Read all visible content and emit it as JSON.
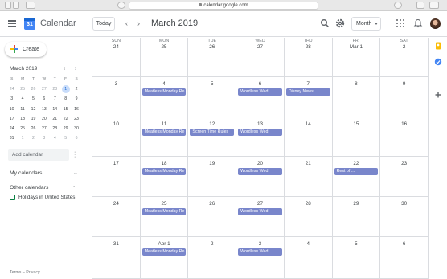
{
  "browser": {
    "url": "calendar.google.com"
  },
  "app": {
    "title": "Calendar",
    "logo_text": "31"
  },
  "header": {
    "today_label": "Today",
    "prev_icon": "chevron-left-icon",
    "next_icon": "chevron-right-icon",
    "month_title": "March 2019",
    "view_label": "Month"
  },
  "sidebar": {
    "create_label": "Create",
    "mini_calendar": {
      "title": "March 2019",
      "days_of_week": [
        "S",
        "M",
        "T",
        "W",
        "T",
        "F",
        "S"
      ],
      "weeks": [
        [
          "24",
          "25",
          "26",
          "27",
          "28",
          "1",
          "2"
        ],
        [
          "3",
          "4",
          "5",
          "6",
          "7",
          "8",
          "9"
        ],
        [
          "10",
          "11",
          "12",
          "13",
          "14",
          "15",
          "16"
        ],
        [
          "17",
          "18",
          "19",
          "20",
          "21",
          "22",
          "23"
        ],
        [
          "24",
          "25",
          "26",
          "27",
          "28",
          "29",
          "30"
        ],
        [
          "31",
          "1",
          "2",
          "3",
          "4",
          "5",
          "6"
        ]
      ],
      "today": "1"
    },
    "add_calendar_placeholder": "Add calendar",
    "my_calendars_label": "My calendars",
    "other_calendars_label": "Other calendars",
    "other_calendars": [
      {
        "label": "Holidays in United States",
        "color": "#0b8043"
      }
    ],
    "footer": "Terms – Privacy"
  },
  "calendar": {
    "days_of_week": [
      "SUN",
      "MON",
      "TUE",
      "WED",
      "THU",
      "FRI",
      "SAT"
    ],
    "event_color": "#7986cb",
    "weeks": [
      [
        {
          "date": "24",
          "events": []
        },
        {
          "date": "25",
          "events": []
        },
        {
          "date": "26",
          "events": []
        },
        {
          "date": "27",
          "events": []
        },
        {
          "date": "28",
          "events": []
        },
        {
          "date": "Mar 1",
          "events": []
        },
        {
          "date": "2",
          "events": []
        }
      ],
      [
        {
          "date": "3",
          "events": []
        },
        {
          "date": "4",
          "events": [
            "Meatless Monday Re"
          ]
        },
        {
          "date": "5",
          "events": []
        },
        {
          "date": "6",
          "events": [
            "Wordless Wed"
          ]
        },
        {
          "date": "7",
          "events": [
            "Disney News"
          ]
        },
        {
          "date": "8",
          "events": []
        },
        {
          "date": "9",
          "events": []
        }
      ],
      [
        {
          "date": "10",
          "events": []
        },
        {
          "date": "11",
          "events": [
            "Meatless Monday Re"
          ]
        },
        {
          "date": "12",
          "events": [
            "Screen Time Rules"
          ]
        },
        {
          "date": "13",
          "events": [
            "Wordless Wed"
          ]
        },
        {
          "date": "14",
          "events": []
        },
        {
          "date": "15",
          "events": []
        },
        {
          "date": "16",
          "events": []
        }
      ],
      [
        {
          "date": "17",
          "events": []
        },
        {
          "date": "18",
          "events": [
            "Meatless Monday Re"
          ]
        },
        {
          "date": "19",
          "events": []
        },
        {
          "date": "20",
          "events": [
            "Wordless Wed"
          ]
        },
        {
          "date": "21",
          "events": []
        },
        {
          "date": "22",
          "events": [
            "Rest of ..."
          ]
        },
        {
          "date": "23",
          "events": []
        }
      ],
      [
        {
          "date": "24",
          "events": []
        },
        {
          "date": "25",
          "events": [
            "Meatless Monday Re"
          ]
        },
        {
          "date": "26",
          "events": []
        },
        {
          "date": "27",
          "events": [
            "Wordless Wed"
          ]
        },
        {
          "date": "28",
          "events": []
        },
        {
          "date": "29",
          "events": []
        },
        {
          "date": "30",
          "events": []
        }
      ],
      [
        {
          "date": "31",
          "events": []
        },
        {
          "date": "Apr 1",
          "events": [
            "Meatless Monday Re"
          ]
        },
        {
          "date": "2",
          "events": []
        },
        {
          "date": "3",
          "events": [
            "Wordless Wed"
          ]
        },
        {
          "date": "4",
          "events": []
        },
        {
          "date": "5",
          "events": []
        },
        {
          "date": "6",
          "events": []
        }
      ]
    ]
  },
  "rail_icons": [
    "keep-icon",
    "tasks-icon",
    "add-icon"
  ]
}
